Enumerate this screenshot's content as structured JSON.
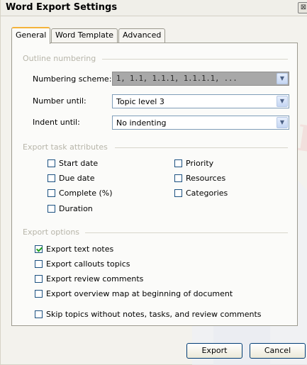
{
  "window": {
    "title": "Word Export Settings",
    "close_glyph": "⊠"
  },
  "tabs": [
    {
      "label": "General",
      "active": true
    },
    {
      "label": "Word Template",
      "active": false
    },
    {
      "label": "Advanced",
      "active": false
    }
  ],
  "outline_numbering": {
    "group_label": "Outline numbering",
    "numbering_scheme": {
      "label": "Numbering scheme:",
      "value": "1, 1.1, 1.1.1, 1.1.1.1, ..."
    },
    "number_until": {
      "label": "Number until:",
      "value": "Topic level 3"
    },
    "indent_until": {
      "label": "Indent until:",
      "value": "No indenting"
    }
  },
  "export_task_attributes": {
    "group_label": "Export task attributes",
    "items": [
      {
        "label": "Start date",
        "checked": false
      },
      {
        "label": "Due date",
        "checked": false
      },
      {
        "label": "Complete (%)",
        "checked": false
      },
      {
        "label": "Duration",
        "checked": false
      },
      {
        "label": "Priority",
        "checked": false
      },
      {
        "label": "Resources",
        "checked": false
      },
      {
        "label": "Categories",
        "checked": false
      }
    ]
  },
  "export_options": {
    "group_label": "Export options",
    "items": [
      {
        "label": "Export text notes",
        "checked": true
      },
      {
        "label": "Export callouts topics",
        "checked": false
      },
      {
        "label": "Export review comments",
        "checked": false
      },
      {
        "label": "Export overview map at beginning of document",
        "checked": false
      },
      {
        "label": "Skip topics without notes, tasks, and review comments",
        "checked": false
      }
    ]
  },
  "buttons": {
    "export": "Export",
    "cancel": "Cancel"
  },
  "watermark": {
    "text": "DropBo"
  },
  "icons": {
    "dropdown": "chevron-down-icon",
    "close": "close-icon"
  }
}
